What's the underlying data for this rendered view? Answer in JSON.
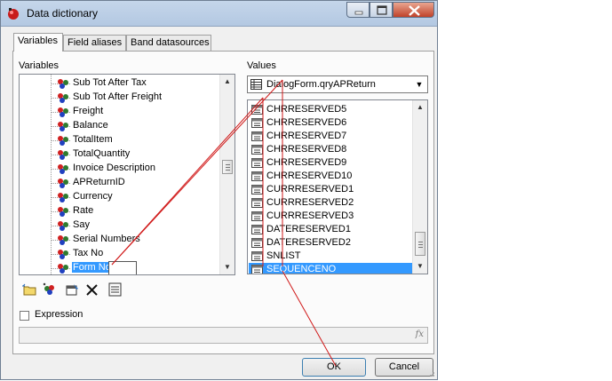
{
  "window": {
    "title": "Data dictionary"
  },
  "tabs": [
    {
      "label": "Variables"
    },
    {
      "label": "Field aliases"
    },
    {
      "label": "Band datasources"
    }
  ],
  "variables": {
    "label": "Variables",
    "items": [
      {
        "label": "Sub Tot After Tax"
      },
      {
        "label": "Sub Tot After Freight"
      },
      {
        "label": "Freight"
      },
      {
        "label": "Balance"
      },
      {
        "label": "TotalItem"
      },
      {
        "label": "TotalQuantity"
      },
      {
        "label": "Invoice Description"
      },
      {
        "label": "APReturnID"
      },
      {
        "label": "Currency"
      },
      {
        "label": "Rate"
      },
      {
        "label": "Say"
      },
      {
        "label": "Serial Numbers"
      },
      {
        "label": "Tax No"
      },
      {
        "label": "Form No"
      }
    ],
    "selected": "Form No"
  },
  "values": {
    "label": "Values",
    "datasource": "DialogForm.qryAPReturn",
    "fields": [
      {
        "label": "CHRRESERVED5"
      },
      {
        "label": "CHRRESERVED6"
      },
      {
        "label": "CHRRESERVED7"
      },
      {
        "label": "CHRRESERVED8"
      },
      {
        "label": "CHRRESERVED9"
      },
      {
        "label": "CHRRESERVED10"
      },
      {
        "label": "CURRRESERVED1"
      },
      {
        "label": "CURRRESERVED2"
      },
      {
        "label": "CURRRESERVED3"
      },
      {
        "label": "DATERESERVED1"
      },
      {
        "label": "DATERESERVED2"
      },
      {
        "label": "SNLIST"
      },
      {
        "label": "SEQUENCENO"
      }
    ],
    "selected": "SEQUENCENO"
  },
  "expression": {
    "label": "Expression",
    "checked": false,
    "value": "",
    "fx": "fx"
  },
  "buttons": {
    "ok": "OK",
    "cancel": "Cancel"
  },
  "toolbar": [
    {
      "icon": "new-category-icon"
    },
    {
      "icon": "new-variable-icon"
    },
    {
      "icon": "edit-icon"
    },
    {
      "icon": "delete-icon"
    },
    {
      "icon": "edit-list-icon"
    }
  ],
  "colors": {
    "selection": "#3399ff",
    "annotation": "#d01818"
  }
}
